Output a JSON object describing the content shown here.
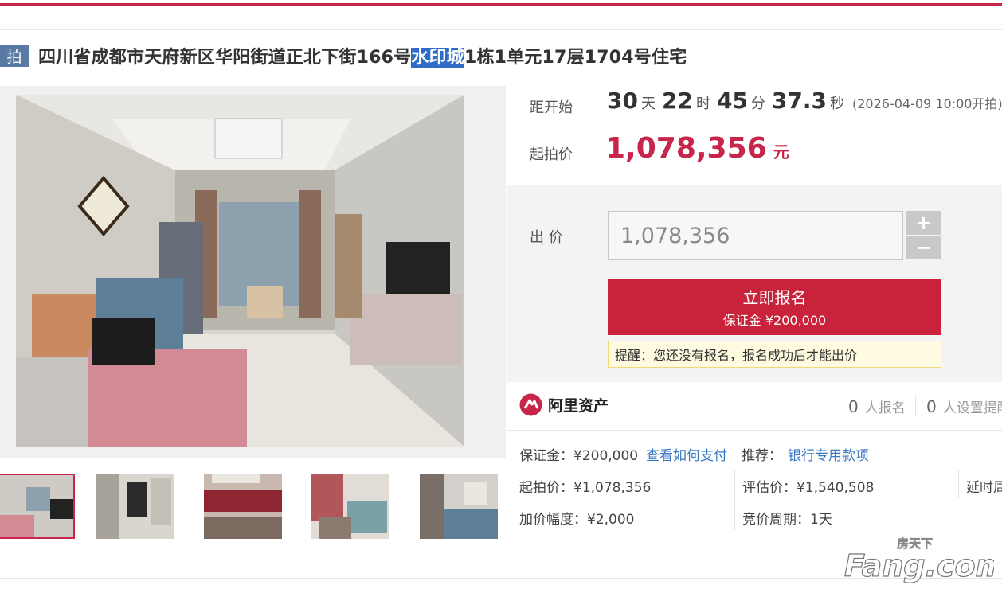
{
  "listing": {
    "tag": "拍",
    "title_before": "四川省成都市天府新区华阳街道正北下街166号",
    "title_highlight": "水印城",
    "title_after": "1栋1单元17层1704号住宅"
  },
  "countdown": {
    "label": "距开始",
    "days": "30",
    "days_unit": "天",
    "hours": "22",
    "hours_unit": "时",
    "minutes": "45",
    "minutes_unit": "分",
    "seconds": "37.3",
    "seconds_unit": "秒",
    "start_time": "(2026-04-09 10:00开拍)"
  },
  "start_price": {
    "label": "起拍价",
    "value": "1,078,356",
    "unit": "元"
  },
  "bid": {
    "label": "出 价",
    "input_value": "1,078,356",
    "plus": "+",
    "minus": "−",
    "signup_label": "立即报名",
    "deposit_label": "保证金 ¥200,000",
    "notice": "提醒：您还没有报名，报名成功后才能出价"
  },
  "platform": {
    "name": "阿里资产",
    "signups_count": "0",
    "signups_label": "人报名",
    "reminders_count": "0",
    "reminders_label": "人设置提醒"
  },
  "details": {
    "deposit": "保证金：¥200,000",
    "how_to_pay": "查看如何支付",
    "recommend_label": "推荐：",
    "recommend_link": "银行专用款项",
    "start_price": "起拍价：¥1,078,356",
    "appraisal": "评估价：¥1,540,508",
    "delay": "延时周期",
    "increment": "加价幅度：¥2,000",
    "cycle": "竞价周期：1天"
  },
  "watermark": {
    "top": "房天下",
    "brand": "Fang.com"
  },
  "colors": {
    "accent": "#c8254a",
    "button": "#c8233a",
    "link": "#3a78c3",
    "tag": "#5a7aa6"
  },
  "icons": [
    "zoom-icon",
    "alibaba-asset-logo"
  ]
}
